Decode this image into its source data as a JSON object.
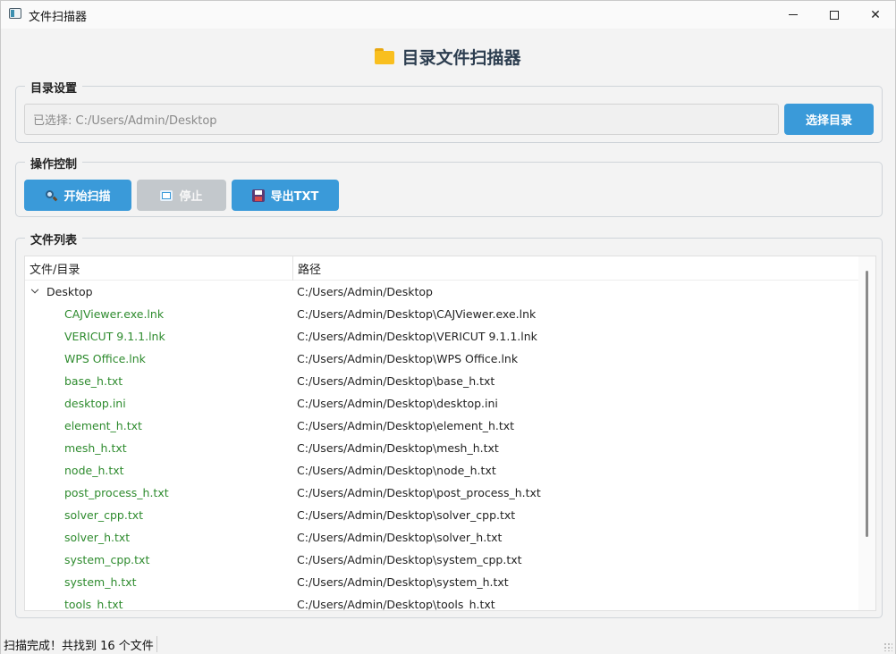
{
  "window": {
    "title": "文件扫描器"
  },
  "header": {
    "title": "目录文件扫描器",
    "icon": "folder-icon"
  },
  "directory_group": {
    "title": "目录设置",
    "path_display": "已选择: C:/Users/Admin/Desktop",
    "choose_label": "选择目录"
  },
  "operations_group": {
    "title": "操作控制",
    "start_label": "开始扫描",
    "stop_label": "停止",
    "export_label": "导出TXT"
  },
  "file_list": {
    "title": "文件列表",
    "columns": [
      "文件/目录",
      "路径"
    ],
    "root": {
      "name": "Desktop",
      "path": "C:/Users/Admin/Desktop",
      "expanded": true
    },
    "items": [
      {
        "name": "CAJViewer.exe.lnk",
        "path": "C:/Users/Admin/Desktop\\CAJViewer.exe.lnk"
      },
      {
        "name": "VERICUT 9.1.1.lnk",
        "path": "C:/Users/Admin/Desktop\\VERICUT 9.1.1.lnk"
      },
      {
        "name": "WPS Office.lnk",
        "path": "C:/Users/Admin/Desktop\\WPS Office.lnk"
      },
      {
        "name": "base_h.txt",
        "path": "C:/Users/Admin/Desktop\\base_h.txt"
      },
      {
        "name": "desktop.ini",
        "path": "C:/Users/Admin/Desktop\\desktop.ini"
      },
      {
        "name": "element_h.txt",
        "path": "C:/Users/Admin/Desktop\\element_h.txt"
      },
      {
        "name": "mesh_h.txt",
        "path": "C:/Users/Admin/Desktop\\mesh_h.txt"
      },
      {
        "name": "node_h.txt",
        "path": "C:/Users/Admin/Desktop\\node_h.txt"
      },
      {
        "name": "post_process_h.txt",
        "path": "C:/Users/Admin/Desktop\\post_process_h.txt"
      },
      {
        "name": "solver_cpp.txt",
        "path": "C:/Users/Admin/Desktop\\solver_cpp.txt"
      },
      {
        "name": "solver_h.txt",
        "path": "C:/Users/Admin/Desktop\\solver_h.txt"
      },
      {
        "name": "system_cpp.txt",
        "path": "C:/Users/Admin/Desktop\\system_cpp.txt"
      },
      {
        "name": "system_h.txt",
        "path": "C:/Users/Admin/Desktop\\system_h.txt"
      },
      {
        "name": "tools_h.txt",
        "path": "C:/Users/Admin/Desktop\\tools_h.txt"
      }
    ]
  },
  "status": {
    "text": "扫描完成！共找到 16 个文件"
  },
  "colors": {
    "accent": "#3a9ad9",
    "disabled": "#c3c8cc",
    "file_name": "#2e8b2e",
    "title": "#2d3e50"
  }
}
